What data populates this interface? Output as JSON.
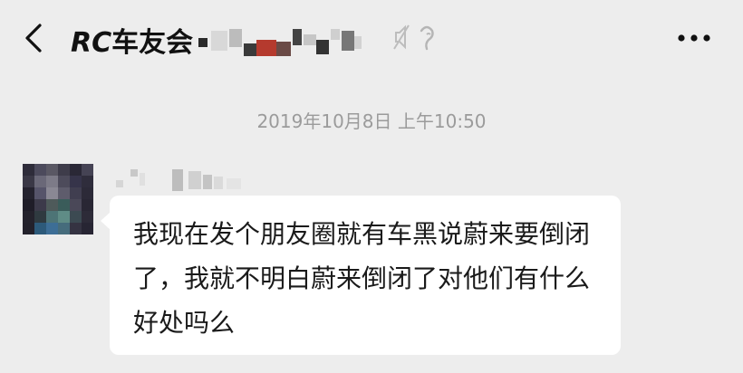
{
  "header": {
    "title": "RC车友会",
    "back_icon": "chevron-left-icon",
    "more_icon": "more-dots-icon",
    "mute_icon": "mute-notifications-icon"
  },
  "chat": {
    "timestamp": "2019年10月8日 上午10:50",
    "messages": [
      {
        "sender": "",
        "text": "我现在发个朋友圈就有车黑说蔚来要倒闭了，我就不明白蔚来倒闭了对他们有什么好处吗么"
      }
    ]
  },
  "colors": {
    "background": "#ededed",
    "bubble": "#ffffff",
    "text": "#1a1a1a",
    "timestamp": "#9b9b9b"
  }
}
